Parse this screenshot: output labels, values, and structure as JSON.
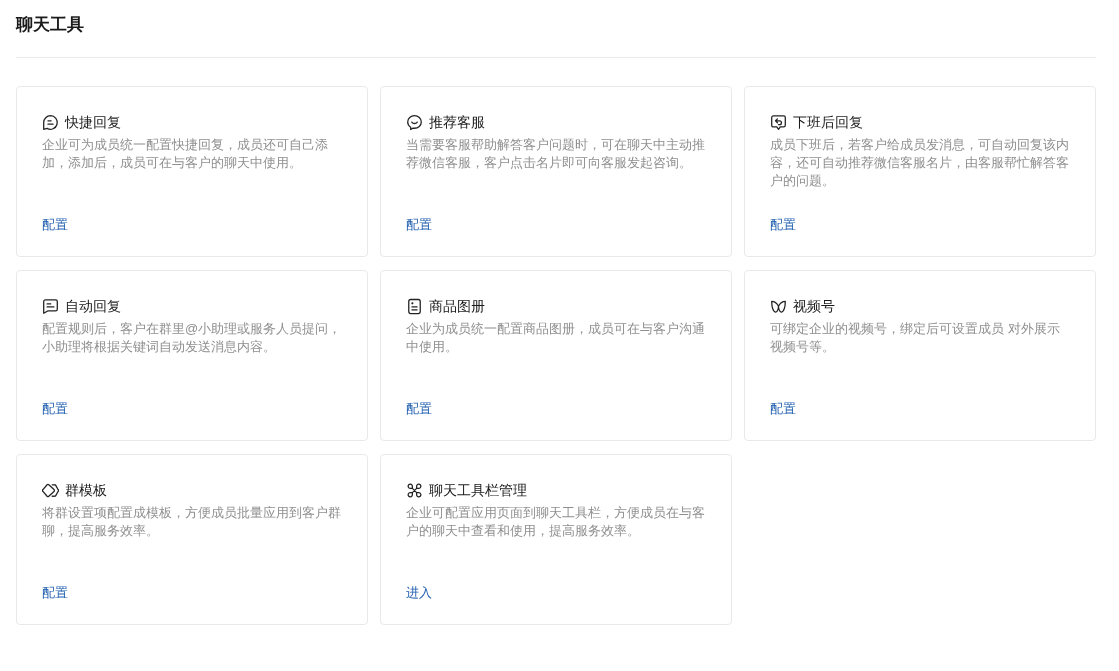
{
  "page": {
    "title": "聊天工具"
  },
  "tools": [
    {
      "kind": "quick-reply",
      "title": "快捷回复",
      "description": "企业可为成员统一配置快捷回复，成员还可自己添加，添加后，成员可在与客户的聊天中使用。",
      "action": "配置"
    },
    {
      "kind": "service",
      "title": "推荐客服",
      "description": "当需要客服帮助解答客户问题时，可在聊天中主动推荐微信客服，客户点击名片即可向客服发起咨询。",
      "action": "配置"
    },
    {
      "kind": "off-duty",
      "title": "下班后回复",
      "description": "成员下班后，若客户给成员发消息，可自动回复该内容，还可自动推荐微信客服名片，由客服帮忙解答客户的问题。",
      "action": "配置"
    },
    {
      "kind": "auto-reply",
      "title": "自动回复",
      "description": "配置规则后，客户在群里@小助理或服务人员提问，小助理将根据关键词自动发送消息内容。",
      "action": "配置"
    },
    {
      "kind": "catalog",
      "title": "商品图册",
      "description": "企业为成员统一配置商品图册，成员可在与客户沟通中使用。",
      "action": "配置"
    },
    {
      "kind": "channels",
      "title": "视频号",
      "description": "可绑定企业的视频号，绑定后可设置成员 对外展示视频号等。",
      "action": "配置"
    },
    {
      "kind": "template",
      "title": "群模板",
      "description": "将群设置项配置成模板，方便成员批量应用到客户群聊，提高服务效率。",
      "action": "配置"
    },
    {
      "kind": "toolbar",
      "title": "聊天工具栏管理",
      "description": "企业可配置应用页面到聊天工具栏，方便成员在与客户的聊天中查看和使用，提高服务效率。",
      "action": "进入"
    }
  ]
}
